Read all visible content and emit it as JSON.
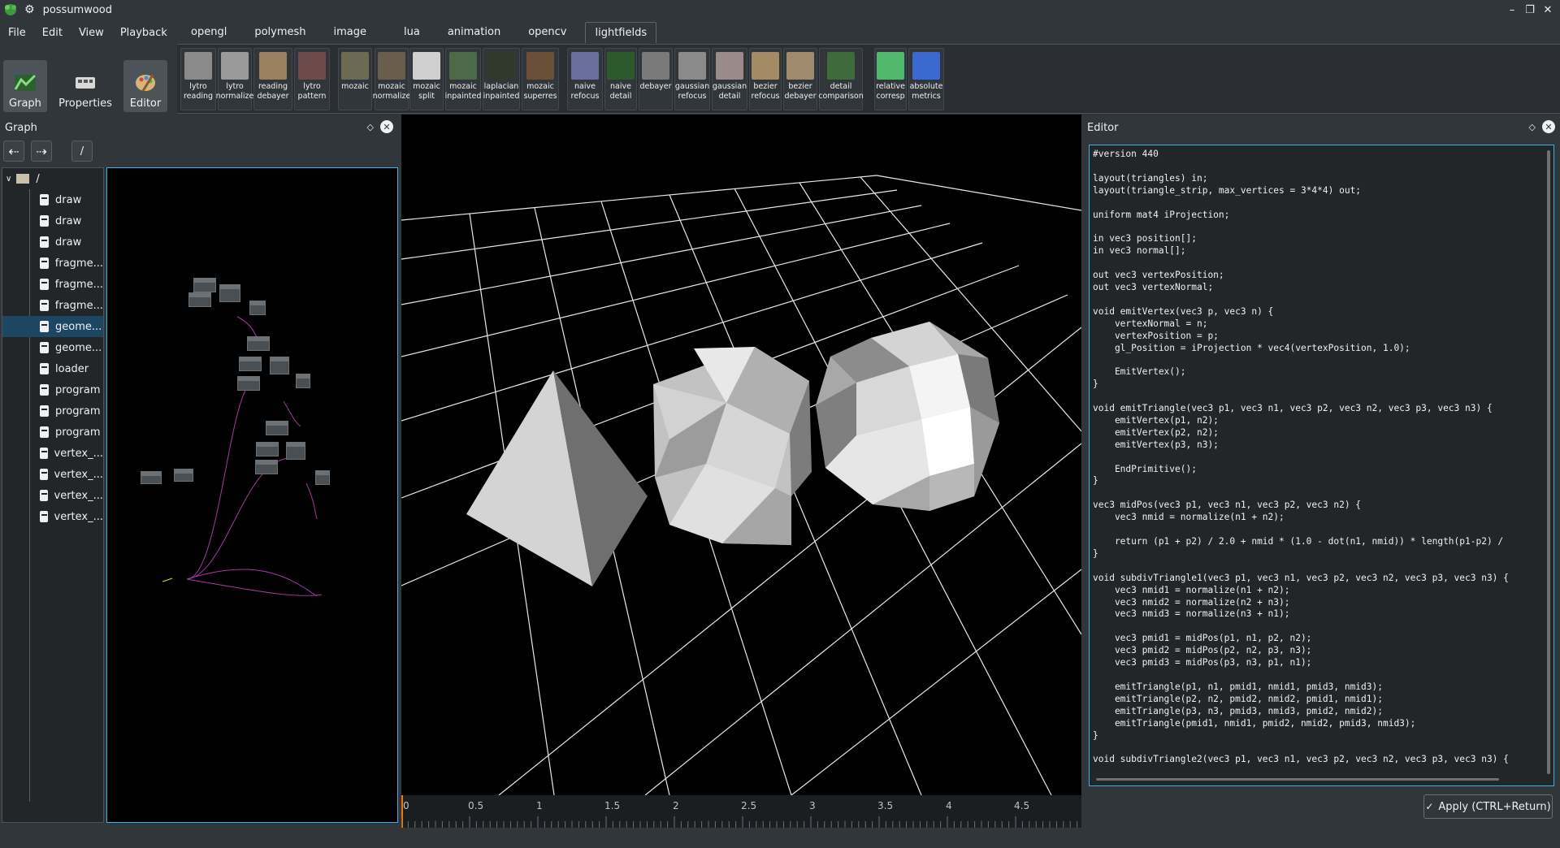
{
  "window": {
    "title": "possumwood",
    "controls": [
      "–",
      "❐",
      "✕"
    ]
  },
  "menu": [
    "File",
    "Edit",
    "View",
    "Playback"
  ],
  "tabs": [
    "opengl",
    "polymesh",
    "image",
    "lua",
    "animation",
    "opencv",
    "lightfields"
  ],
  "active_tab": "lightfields",
  "modes": [
    {
      "label": "Graph",
      "icon": "graph-icon",
      "active": true
    },
    {
      "label": "Properties",
      "icon": "properties-icon",
      "active": false
    },
    {
      "label": "Editor",
      "icon": "palette-icon",
      "active": true
    }
  ],
  "toolbar": [
    {
      "label1": "lytro",
      "label2": "reading",
      "icon": "lytro-reading-icon",
      "color": "#8a8a8a"
    },
    {
      "label1": "lytro",
      "label2": "normalize",
      "icon": "lytro-normalize-icon",
      "color": "#9a9a9a"
    },
    {
      "label1": "reading",
      "label2": "debayer",
      "icon": "reading-debayer-icon",
      "color": "#9c7f5e"
    },
    {
      "label1": "lytro",
      "label2": "pattern",
      "icon": "lytro-pattern-icon",
      "color": "#6e4a4a"
    },
    {
      "label1": "mozaic",
      "label2": "",
      "icon": "mozaic-icon",
      "color": "#6c6a52"
    },
    {
      "label1": "mozaic",
      "label2": "normalize",
      "icon": "mozaic-normalize-icon",
      "color": "#6a5d4c"
    },
    {
      "label1": "mozaic",
      "label2": "split",
      "icon": "mozaic-split-icon",
      "color": "#cfcfcf"
    },
    {
      "label1": "mozaic",
      "label2": "inpainted",
      "icon": "mozaic-inpainted-icon",
      "color": "#4d6a48"
    },
    {
      "label1": "laplacian",
      "label2": "inpainted",
      "icon": "laplacian-inpainted-icon",
      "color": "#2f3a2c"
    },
    {
      "label1": "mozaic",
      "label2": "superres",
      "icon": "mozaic-superres-icon",
      "color": "#6b5038"
    },
    {
      "label1": "naive",
      "label2": "refocus",
      "icon": "naive-refocus-icon",
      "color": "#6a6fa0"
    },
    {
      "label1": "naive",
      "label2": "detail",
      "icon": "naive-detail-icon",
      "color": "#2c5a2c"
    },
    {
      "label1": "debayer",
      "label2": "",
      "icon": "debayer-icon",
      "color": "#7a7a7a"
    },
    {
      "label1": "gaussian",
      "label2": "refocus",
      "icon": "gaussian-refocus-icon",
      "color": "#8a8a8a"
    },
    {
      "label1": "gaussian",
      "label2": "detail",
      "icon": "gaussian-detail-icon",
      "color": "#9a8a8a"
    },
    {
      "label1": "bezier",
      "label2": "refocus",
      "icon": "bezier-refocus-icon",
      "color": "#a58a68"
    },
    {
      "label1": "bezier",
      "label2": "debayer",
      "icon": "bezier-debayer-icon",
      "color": "#a08a6e"
    },
    {
      "label1": "detail",
      "label2": "comparison",
      "icon": "detail-comparison-icon",
      "color": "#3f6a3a"
    },
    {
      "label1": "relative",
      "label2": "corresp",
      "icon": "relative-corresp-icon",
      "color": "#4fb86a"
    },
    {
      "label1": "absolute",
      "label2": "metrics",
      "icon": "absolute-metrics-icon",
      "color": "#3a6ad0"
    }
  ],
  "graph_panel": {
    "title": "Graph",
    "path": "/",
    "tree_root": "/",
    "tree_items": [
      "draw",
      "draw",
      "draw",
      "fragme...",
      "fragme...",
      "fragme...",
      "geome...",
      "geome...",
      "loader",
      "program",
      "program",
      "program",
      "vertex_...",
      "vertex_...",
      "vertex_...",
      "vertex_..."
    ],
    "selected_index": 6
  },
  "timeline": {
    "ticks": [
      "0",
      "0.5",
      "1",
      "1.5",
      "2",
      "2.5",
      "3",
      "3.5",
      "4",
      "4.5"
    ]
  },
  "editor": {
    "title": "Editor",
    "code": "#version 440\n\nlayout(triangles) in;\nlayout(triangle_strip, max_vertices = 3*4*4) out;\n\nuniform mat4 iProjection;\n\nin vec3 position[];\nin vec3 normal[];\n\nout vec3 vertexPosition;\nout vec3 vertexNormal;\n\nvoid emitVertex(vec3 p, vec3 n) {\n    vertexNormal = n;\n    vertexPosition = p;\n    gl_Position = iProjection * vec4(vertexPosition, 1.0);\n\n    EmitVertex();\n}\n\nvoid emitTriangle(vec3 p1, vec3 n1, vec3 p2, vec3 n2, vec3 p3, vec3 n3) {\n    emitVertex(p1, n2);\n    emitVertex(p2, n2);\n    emitVertex(p3, n3);\n\n    EndPrimitive();\n}\n\nvec3 midPos(vec3 p1, vec3 n1, vec3 p2, vec3 n2) {\n    vec3 nmid = normalize(n1 + n2);\n\n    return (p1 + p2) / 2.0 + nmid * (1.0 - dot(n1, nmid)) * length(p1-p2) /\n}\n\nvoid subdivTriangle1(vec3 p1, vec3 n1, vec3 p2, vec3 n2, vec3 p3, vec3 n3) {\n    vec3 nmid1 = normalize(n1 + n2);\n    vec3 nmid2 = normalize(n2 + n3);\n    vec3 nmid3 = normalize(n3 + n1);\n\n    vec3 pmid1 = midPos(p1, n1, p2, n2);\n    vec3 pmid2 = midPos(p2, n2, p3, n3);\n    vec3 pmid3 = midPos(p3, n3, p1, n1);\n\n    emitTriangle(p1, n1, pmid1, nmid1, pmid3, nmid3);\n    emitTriangle(p2, n2, pmid2, nmid2, pmid1, nmid1);\n    emitTriangle(p3, n3, pmid3, nmid3, pmid2, nmid2);\n    emitTriangle(pmid1, nmid1, pmid2, nmid2, pmid3, nmid3);\n}\n\nvoid subdivTriangle2(vec3 p1, vec3 n1, vec3 p2, vec3 n2, vec3 p3, vec3 n3) {",
    "apply_label": "Apply (CTRL+Return)"
  }
}
